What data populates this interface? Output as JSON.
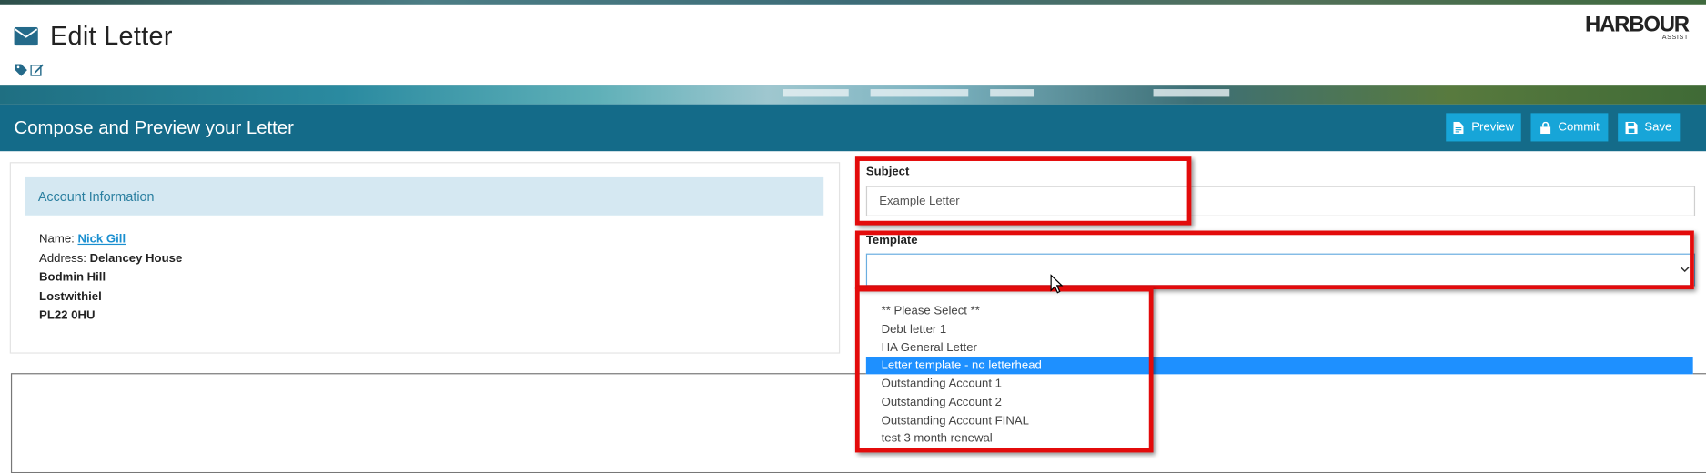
{
  "header": {
    "title": "Edit Letter",
    "logo_text": "HARBOUR",
    "logo_sub": "ASSIST"
  },
  "toolbar": {
    "title": "Compose and Preview your Letter",
    "preview_label": "Preview",
    "commit_label": "Commit",
    "save_label": "Save"
  },
  "account": {
    "heading": "Account Information",
    "name_label": "Name:",
    "name_value": "Nick Gill",
    "address_label": "Address:",
    "address_lines": [
      "Delancey House",
      "Bodmin Hill",
      "Lostwithiel",
      "PL22 0HU"
    ]
  },
  "form": {
    "subject_label": "Subject",
    "subject_value": "Example Letter",
    "template_label": "Template",
    "template_value": "",
    "template_options": [
      "** Please Select **",
      "Debt letter 1",
      "HA General Letter",
      "Letter template - no letterhead",
      "Outstanding Account 1",
      "Outstanding Account 2",
      "Outstanding Account FINAL",
      "test 3 month renewal"
    ],
    "highlighted_option": "Letter template - no letterhead"
  },
  "colors": {
    "bar": "#146b89",
    "button": "#17a5d8",
    "highlight_box": "#e30b0b",
    "selected_option": "#1e90ff"
  },
  "icons": [
    "envelope-icon",
    "tag-icon",
    "edit-icon",
    "file-icon",
    "lock-icon",
    "floppy-disk-icon",
    "chevron-down-icon",
    "mouse-cursor-icon"
  ]
}
